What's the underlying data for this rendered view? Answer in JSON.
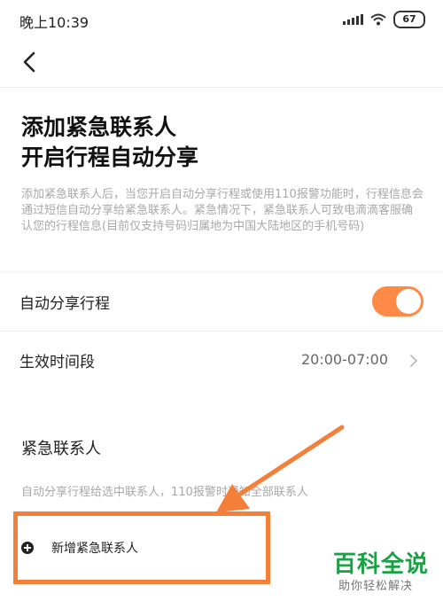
{
  "status_bar": {
    "time": "晚上10:39",
    "battery": "67"
  },
  "nav": {
    "back_icon": "chevron-left-icon"
  },
  "hero": {
    "title_line1": "添加紧急联系人",
    "title_line2": "开启行程自动分享",
    "description": "添加紧急联系人后，当您开启自动分享行程或使用110报警功能时，行程信息会通过短信自动分享给紧急联系人。紧急情况下，紧急联系人可致电滴滴客服确认您的行程信息(目前仅支持号码归属地为中国大陆地区的手机号码)"
  },
  "settings": {
    "auto_share": {
      "label": "自动分享行程",
      "enabled": true
    },
    "time_period": {
      "label": "生效时间段",
      "value": "20:00-07:00"
    }
  },
  "contacts": {
    "title": "紧急联系人",
    "hint": "自动分享行程给选中联系人，110报警时通知全部联系人",
    "add_label": "新增紧急联系人"
  },
  "annotation": {
    "highlight_color": "#f47f39"
  },
  "watermark": {
    "main": "百科全说",
    "sub": "助你轻松解决"
  },
  "colors": {
    "accent": "#ff8a47",
    "watermark_green": "#1ca044"
  }
}
